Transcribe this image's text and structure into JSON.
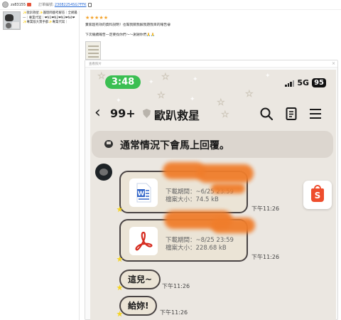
{
  "review_header": {
    "username": "zs83155",
    "order_label": "訂單編號:",
    "order_id": "23082254SG7FFK"
  },
  "product": {
    "title": "✨歐趴救星✨護理師國考解答｜全網最一｜專業代寫｜❤N1❤N2❤N3❤N4❤ ✨專業版大寶手都✨專業代寫｜"
  },
  "review": {
    "stars": "★★★★★",
    "line1": "賣家超有效的資料說明！也幫我關我解我題我目的報告😁",
    "line2": "下次繼續報告一定要找你們～～謝謝你們🙏🙏"
  },
  "panel": {
    "title": "查看照片",
    "close": "×"
  },
  "phone": {
    "time": "3:48",
    "network": "5G",
    "battery": "95",
    "unread_count": "99+",
    "chat_name": "歐趴救星",
    "notice": "通常情況下會馬上回覆。",
    "files": [
      {
        "type": "word",
        "expiry": "下載期間：~6/25 23:59",
        "size": "檔案大小：74.5 kB",
        "time": "下午11:26"
      },
      {
        "type": "pdf",
        "expiry": "下載期間：~8/25 23:59",
        "size": "檔案大小：228.68 kB",
        "time": "下午11:26"
      }
    ],
    "messages": [
      {
        "text": "這兒~",
        "time": "下午11:26"
      },
      {
        "text": "給妳!",
        "time": "下午11:26"
      }
    ],
    "shopee_letter": "S"
  },
  "colors": {
    "accent_green": "#3bbf52",
    "shopee_orange": "#ee4d2d",
    "star_gold": "#f3a22a",
    "link_blue": "#2a6bd6"
  },
  "icons": [
    "copy-icon",
    "search-icon",
    "notes-icon",
    "menu-icon",
    "back-icon",
    "shield-icon",
    "chat-bubble-icon",
    "word-file-icon",
    "pdf-file-icon",
    "shopee-bag-icon",
    "star-icon"
  ]
}
